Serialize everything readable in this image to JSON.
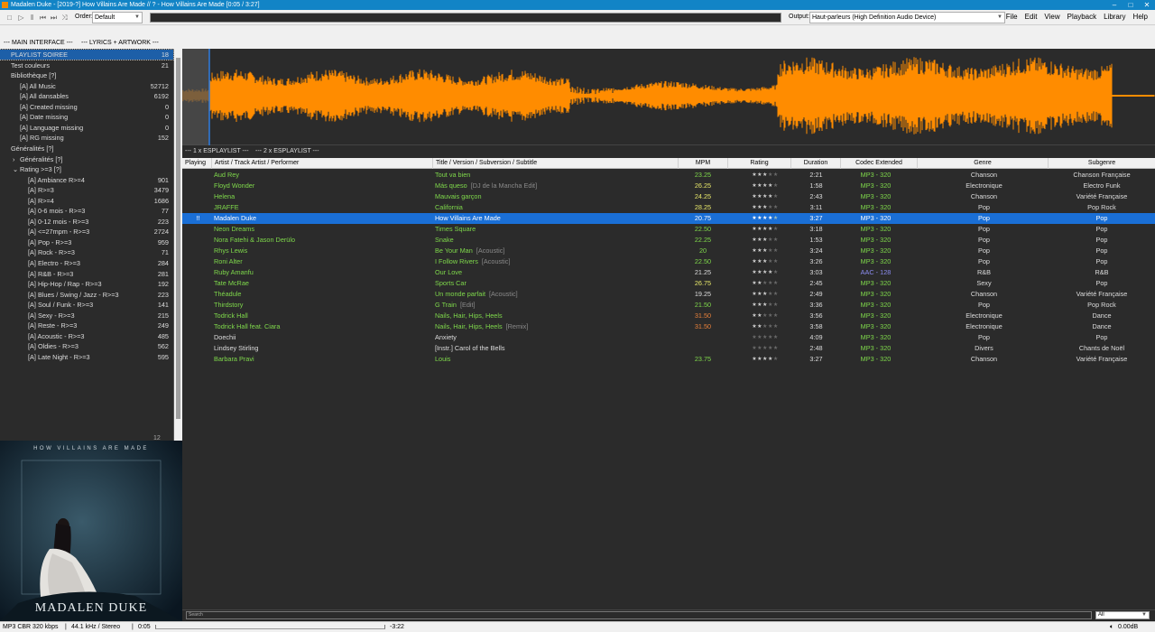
{
  "window": {
    "title": "Madalen Duke  -  [2019-?]  How Villains Are Made  //  ?  -  How Villains Are Made  [0:05 / 3:27]"
  },
  "toolbar": {
    "order_label": "Order:",
    "order_value": "Default",
    "output_label": "Output:",
    "output_value": "Haut-parleurs (High Definition Audio Device)",
    "menu": [
      "File",
      "Edit",
      "View",
      "Playback",
      "Library",
      "Help"
    ]
  },
  "layout_tabs": [
    "--- MAIN INTERFACE ---",
    "--- LYRICS + ARTWORK ---"
  ],
  "playlist_tree": [
    {
      "label": "PLAYLIST SOIREE",
      "count": "18",
      "level": 0,
      "selected": true
    },
    {
      "label": "Test couleurs",
      "count": "21",
      "level": 0
    },
    {
      "label": "Bibliothèque [?]",
      "count": "",
      "level": 0
    },
    {
      "label": "[A] All Music",
      "count": "52712",
      "level": 1
    },
    {
      "label": "[A] All dansables",
      "count": "6192",
      "level": 1
    },
    {
      "label": "[A] Created missing",
      "count": "0",
      "level": 1
    },
    {
      "label": "[A] Date missing",
      "count": "0",
      "level": 1
    },
    {
      "label": "[A] Language missing",
      "count": "0",
      "level": 1
    },
    {
      "label": "[A] RG missing",
      "count": "152",
      "level": 1
    },
    {
      "label": "Généralités [?]",
      "count": "",
      "level": 0
    },
    {
      "label": "Généralités [?]",
      "count": "",
      "level": 1,
      "arrow": "›"
    },
    {
      "label": "Rating >=3 [?]",
      "count": "",
      "level": 1,
      "arrow": "⌄"
    },
    {
      "label": "[A] Ambiance R>=4",
      "count": "901",
      "level": 2
    },
    {
      "label": "[A] R>=3",
      "count": "3479",
      "level": 2
    },
    {
      "label": "[A] R>=4",
      "count": "1686",
      "level": 2
    },
    {
      "label": "[A] 0-6 mois - R>=3",
      "count": "77",
      "level": 2
    },
    {
      "label": "[A] 0-12 mois - R>=3",
      "count": "223",
      "level": 2
    },
    {
      "label": "[A] <=27mpm - R>=3",
      "count": "2724",
      "level": 2
    },
    {
      "label": "[A] Pop - R>=3",
      "count": "959",
      "level": 2
    },
    {
      "label": "[A] Rock - R>=3",
      "count": "71",
      "level": 2
    },
    {
      "label": "[A] Electro - R>=3",
      "count": "284",
      "level": 2
    },
    {
      "label": "[A] R&B - R>=3",
      "count": "281",
      "level": 2
    },
    {
      "label": "[A] Hip-Hop / Rap - R>=3",
      "count": "192",
      "level": 2
    },
    {
      "label": "[A] Blues / Swing / Jazz - R>=3",
      "count": "223",
      "level": 2
    },
    {
      "label": "[A] Soul / Funk - R>=3",
      "count": "141",
      "level": 2
    },
    {
      "label": "[A] Sexy - R>=3",
      "count": "215",
      "level": 2
    },
    {
      "label": "[A] Reste - R>=3",
      "count": "249",
      "level": 2
    },
    {
      "label": "[A] Acoustic - R>=3",
      "count": "485",
      "level": 2
    },
    {
      "label": "[A] Oldies - R>=3",
      "count": "562",
      "level": 2
    },
    {
      "label": "[A] Late Night - R>=3",
      "count": "595",
      "level": 2
    }
  ],
  "left_footer_count": "12",
  "artwork": {
    "top_text": "HOW VILLAINS ARE MADE",
    "bottom_text": "MADALEN DUKE"
  },
  "playlist_tabs": [
    "--- 1 x ESPLAYLIST ---",
    "--- 2 x ESPLAYLIST ---"
  ],
  "columns": [
    "Playing",
    "Artist / Track Artist / Performer",
    "Title / Version / Subversion / Subtitle",
    "MPM",
    "Rating",
    "Duration",
    "Codec Extended",
    "Genre",
    "Subgenre"
  ],
  "tracks": [
    {
      "artist": "Aud Rey",
      "title": "Tout va bien",
      "sub": "",
      "mpm": "23.25",
      "mpm_color": "#7fd94b",
      "stars": 3,
      "duration": "2:21",
      "codec": "MP3 - 320",
      "genre": "Chanson",
      "subgenre": "Chanson Française"
    },
    {
      "artist": "Floyd Wonder",
      "title": "Más queso",
      "sub": "[DJ de la Mancha Edit]",
      "mpm": "26.25",
      "mpm_color": "#e8e86a",
      "stars": 4,
      "duration": "1:58",
      "codec": "MP3 - 320",
      "genre": "Electronique",
      "subgenre": "Electro Funk"
    },
    {
      "artist": "Helena",
      "title": "Mauvais garçon",
      "sub": "",
      "mpm": "24.25",
      "mpm_color": "#e8e86a",
      "stars": 4,
      "duration": "2:43",
      "codec": "MP3 - 320",
      "genre": "Chanson",
      "subgenre": "Variété Française"
    },
    {
      "artist": "JRAFFE",
      "title": "California",
      "sub": "",
      "mpm": "28.25",
      "mpm_color": "#e8e86a",
      "stars": 3,
      "duration": "3:11",
      "codec": "MP3 - 320",
      "genre": "Pop",
      "subgenre": "Pop Rock"
    },
    {
      "artist": "Madalen Duke",
      "title": "How Villains Are Made",
      "sub": "",
      "mpm": "20.75",
      "mpm_color": "#ffffff",
      "stars": 4,
      "duration": "3:27",
      "codec": "MP3 - 320",
      "genre": "Pop",
      "subgenre": "Pop",
      "selected": true,
      "playing": "!!"
    },
    {
      "artist": "Neon Dreams",
      "title": "Times Square",
      "sub": "",
      "mpm": "22.50",
      "mpm_color": "#7fd94b",
      "stars": 4,
      "duration": "3:18",
      "codec": "MP3 - 320",
      "genre": "Pop",
      "subgenre": "Pop"
    },
    {
      "artist": "Nora Fatehi & Jason Derülo",
      "title": "Snake",
      "sub": "",
      "mpm": "22.25",
      "mpm_color": "#7fd94b",
      "stars": 3,
      "duration": "1:53",
      "codec": "MP3 - 320",
      "genre": "Pop",
      "subgenre": "Pop"
    },
    {
      "artist": "Rhys Lewis",
      "title": "Be Your Man",
      "sub": "[Acoustic]",
      "mpm": "20",
      "mpm_color": "#7fd94b",
      "stars": 3,
      "duration": "3:24",
      "codec": "MP3 - 320",
      "genre": "Pop",
      "subgenre": "Pop"
    },
    {
      "artist": "Roni Alter",
      "title": "I Follow Rivers",
      "sub": "[Acoustic]",
      "mpm": "22.50",
      "mpm_color": "#7fd94b",
      "stars": 3,
      "duration": "3:26",
      "codec": "MP3 - 320",
      "genre": "Pop",
      "subgenre": "Pop"
    },
    {
      "artist": "Ruby Amanfu",
      "title": "Our Love",
      "sub": "",
      "mpm": "21.25",
      "mpm_color": "#dddddd",
      "stars": 4,
      "duration": "3:03",
      "codec": "AAC - 128",
      "codec_color": "#8c8cf0",
      "genre": "R&B",
      "subgenre": "R&B"
    },
    {
      "artist": "Tate McRae",
      "title": "Sports Car",
      "sub": "",
      "mpm": "26.75",
      "mpm_color": "#e8e86a",
      "stars": 2,
      "duration": "2:45",
      "codec": "MP3 - 320",
      "genre": "Sexy",
      "subgenre": "Pop"
    },
    {
      "artist": "Théadule",
      "title": "Un monde parfait",
      "sub": "[Acoustic]",
      "mpm": "19.25",
      "mpm_color": "#dddddd",
      "stars": 3,
      "duration": "2:49",
      "codec": "MP3 - 320",
      "genre": "Chanson",
      "subgenre": "Variété Française"
    },
    {
      "artist": "Thirdstory",
      "title": "G Train",
      "sub": "[Edit]",
      "mpm": "21.50",
      "mpm_color": "#7fd94b",
      "stars": 3,
      "duration": "3:36",
      "codec": "MP3 - 320",
      "genre": "Pop",
      "subgenre": "Pop Rock"
    },
    {
      "artist": "Todrick Hall",
      "title": "Nails, Hair, Hips, Heels",
      "sub": "",
      "mpm": "31.50",
      "mpm_color": "#e8803a",
      "stars": 2,
      "duration": "3:56",
      "codec": "MP3 - 320",
      "genre": "Electronique",
      "subgenre": "Dance"
    },
    {
      "artist": "Todrick Hall feat. Ciara",
      "title": "Nails, Hair, Hips, Heels",
      "sub": "[Remix]",
      "mpm": "31.50",
      "mpm_color": "#e8803a",
      "stars": 2,
      "duration": "3:58",
      "codec": "MP3 - 320",
      "genre": "Electronique",
      "subgenre": "Dance"
    },
    {
      "artist": "Doechii",
      "title": "Anxiety",
      "sub": "",
      "mpm": "",
      "mpm_color": "#dddddd",
      "stars": 0,
      "duration": "4:09",
      "codec": "MP3 - 320",
      "genre": "Pop",
      "subgenre": "Pop",
      "plain": true
    },
    {
      "artist": "Lindsey Stirling",
      "title": "[Instr.]  Carol of the Bells",
      "sub": "",
      "mpm": "",
      "mpm_color": "#dddddd",
      "stars": 0,
      "duration": "2:48",
      "codec": "MP3 - 320",
      "genre": "Divers",
      "subgenre": "Chants de Noël",
      "plain": true
    },
    {
      "artist": "Barbara Pravi",
      "title": "Louis",
      "sub": "",
      "mpm": "23.75",
      "mpm_color": "#7fd94b",
      "stars": 4,
      "duration": "3:27",
      "codec": "MP3 - 320",
      "genre": "Chanson",
      "subgenre": "Variété Française"
    }
  ],
  "search": {
    "placeholder": "Search",
    "scope": "All"
  },
  "status": {
    "format": "MP3 CBR 320 kbps",
    "rate": "44.1 kHz  /  Stereo",
    "position": "0:05",
    "remaining": "-3:22",
    "volume": "0.00dB"
  },
  "colors": {
    "accent": "#1284c6",
    "waveform": "#ff8c00",
    "selection": "#1a6fd6",
    "track_text": "#7fd94b"
  }
}
